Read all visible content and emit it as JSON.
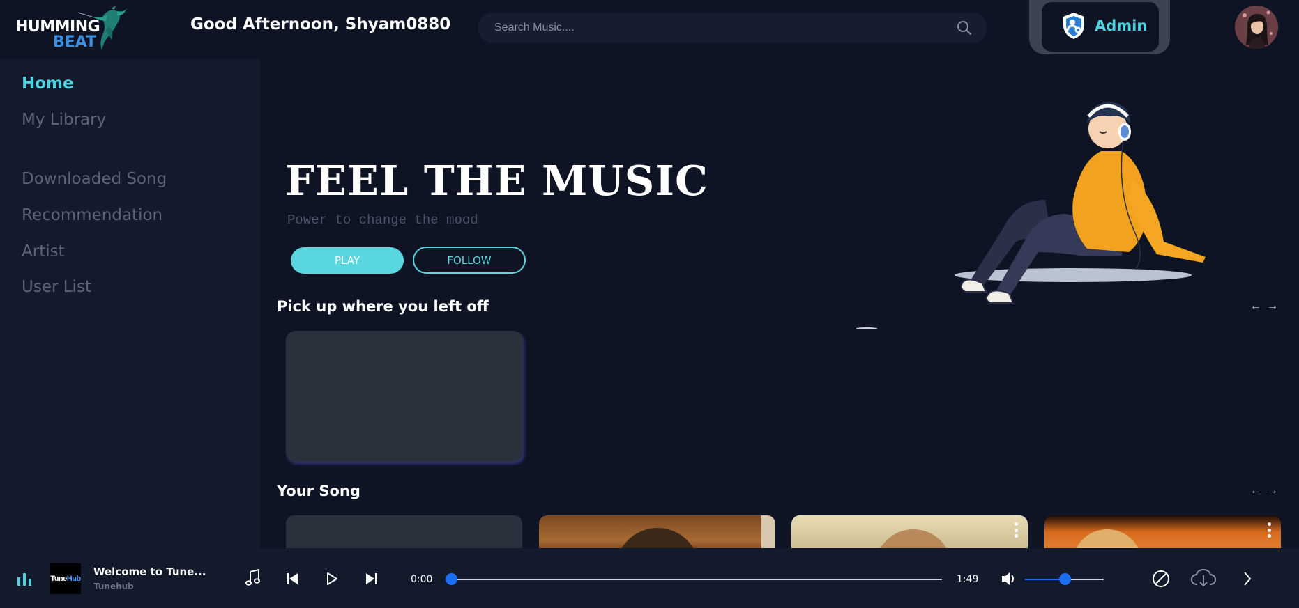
{
  "app": {
    "logo_line1": "HUMMING",
    "logo_line2": "BEAT",
    "greeting": "Good Afternoon, Shyam0880"
  },
  "search": {
    "placeholder": "Search Music....",
    "icon": "search-icon"
  },
  "admin": {
    "label": "Admin",
    "icon": "admin-shield-icon"
  },
  "sidebar": {
    "items": [
      {
        "label": "Home",
        "active": true
      },
      {
        "label": "My Library",
        "active": false
      },
      {
        "label": "Downloaded Song",
        "active": false
      },
      {
        "label": "Recommendation",
        "active": false
      },
      {
        "label": "Artist",
        "active": false
      },
      {
        "label": "User List",
        "active": false
      }
    ]
  },
  "hero": {
    "title": "FEEL THE MUSIC",
    "subtitle": "Power to change the mood",
    "play_label": "PLAY",
    "follow_label": "FOLLOW"
  },
  "sections": {
    "recent": {
      "title": "Pick up where you left off"
    },
    "your_song": {
      "title": "Your Song"
    }
  },
  "nav_arrows": {
    "prev": "←",
    "next": "→"
  },
  "player": {
    "track_thumb_a": "Tune",
    "track_thumb_b": "Hub",
    "track_title": "Welcome to Tune...",
    "track_artist": "Tunehub",
    "current_time": "0:00",
    "duration": "1:49",
    "progress": 0.0,
    "volume": 0.5
  },
  "colors": {
    "accent": "#4fd3e0",
    "background": "#0e1424",
    "sidebar": "#121a2b",
    "slider": "#1a6df5"
  }
}
